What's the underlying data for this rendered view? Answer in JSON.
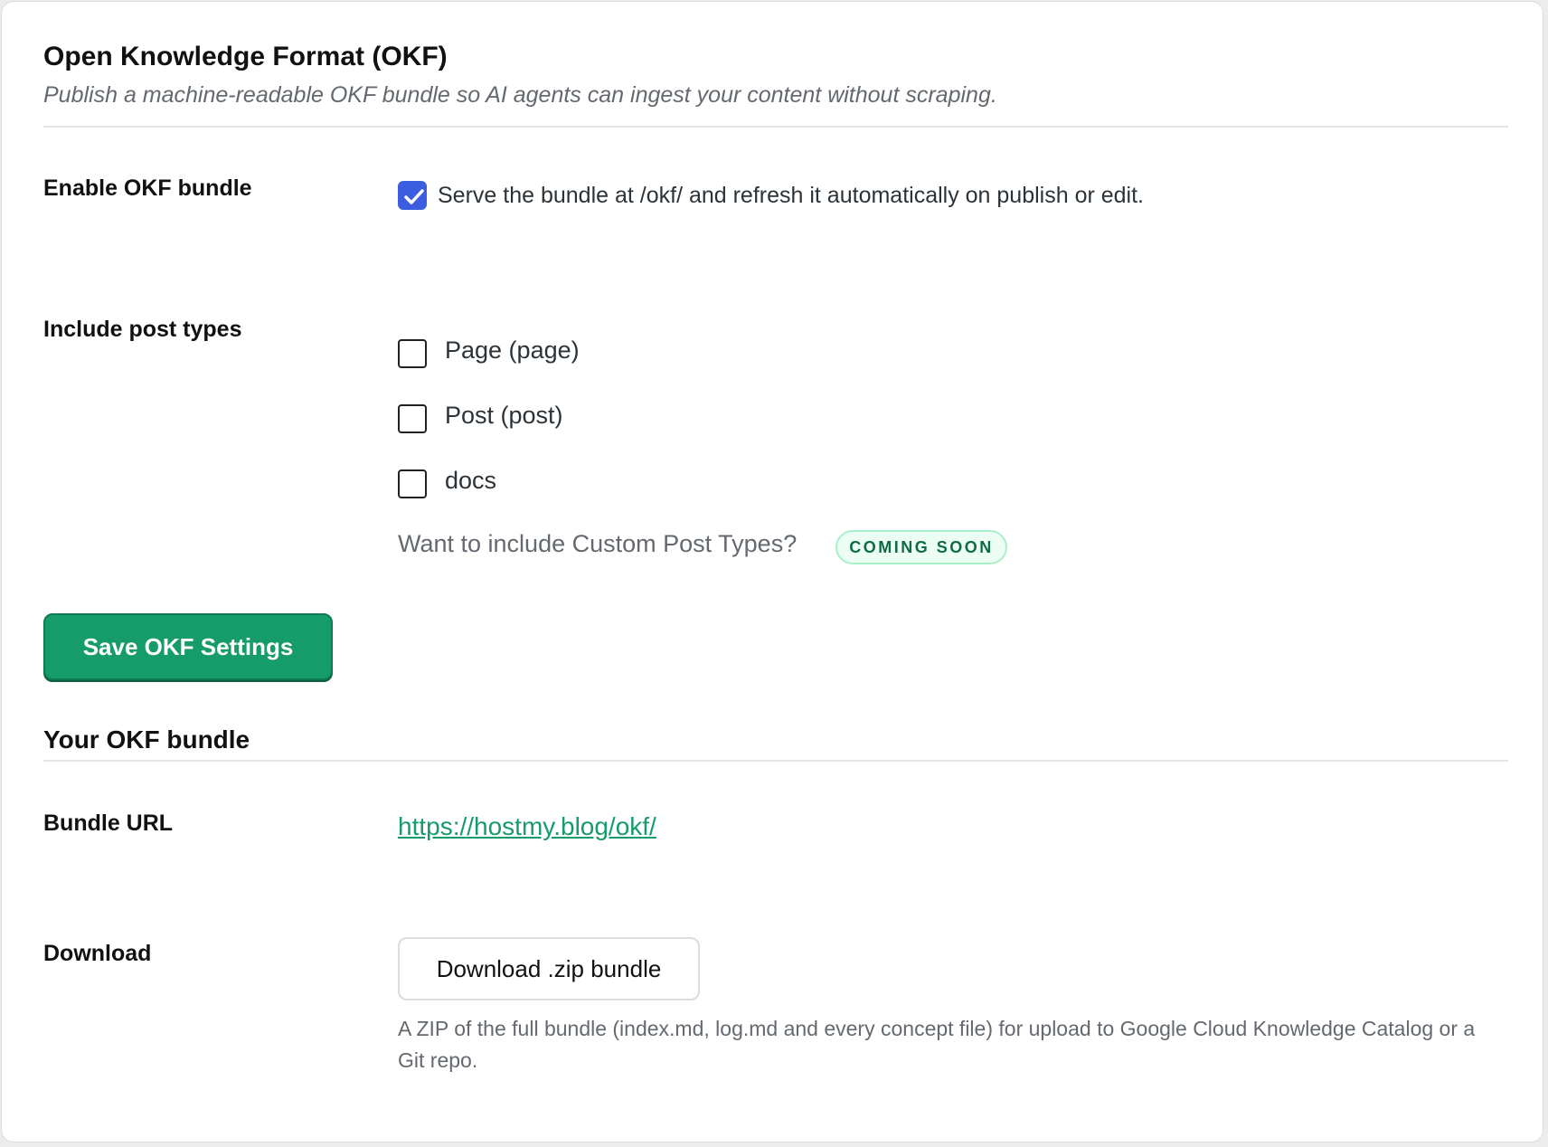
{
  "header": {
    "title": "Open Knowledge Format (OKF)",
    "description": "Publish a machine-readable OKF bundle so AI agents can ingest your content without scraping."
  },
  "enable": {
    "label": "Enable OKF bundle",
    "checked": true,
    "checkbox_text": "Serve the bundle at /okf/ and refresh it automatically on publish or edit."
  },
  "post_types": {
    "label": "Include post types",
    "options": [
      {
        "label": "Page (page)",
        "checked": false
      },
      {
        "label": "Post (post)",
        "checked": false
      },
      {
        "label": "docs",
        "checked": false
      }
    ],
    "custom_prompt": "Want to include Custom Post Types?",
    "badge": "COMING SOON"
  },
  "save_button": "Save OKF Settings",
  "bundle": {
    "title": "Your OKF bundle",
    "url_label": "Bundle URL",
    "url": "https://hostmy.blog/okf/",
    "download_label": "Download",
    "download_button": "Download .zip bundle",
    "download_description": "A ZIP of the full bundle (index.md, log.md and every concept file) for upload to Google Cloud Knowledge Catalog or a Git repo."
  },
  "colors": {
    "accent_green": "#169c6a",
    "checkbox_blue": "#3b5ee0",
    "badge_text": "#0e6b45",
    "badge_bg": "#ecfdf4"
  },
  "icons": {
    "checkmark": "check-icon"
  }
}
